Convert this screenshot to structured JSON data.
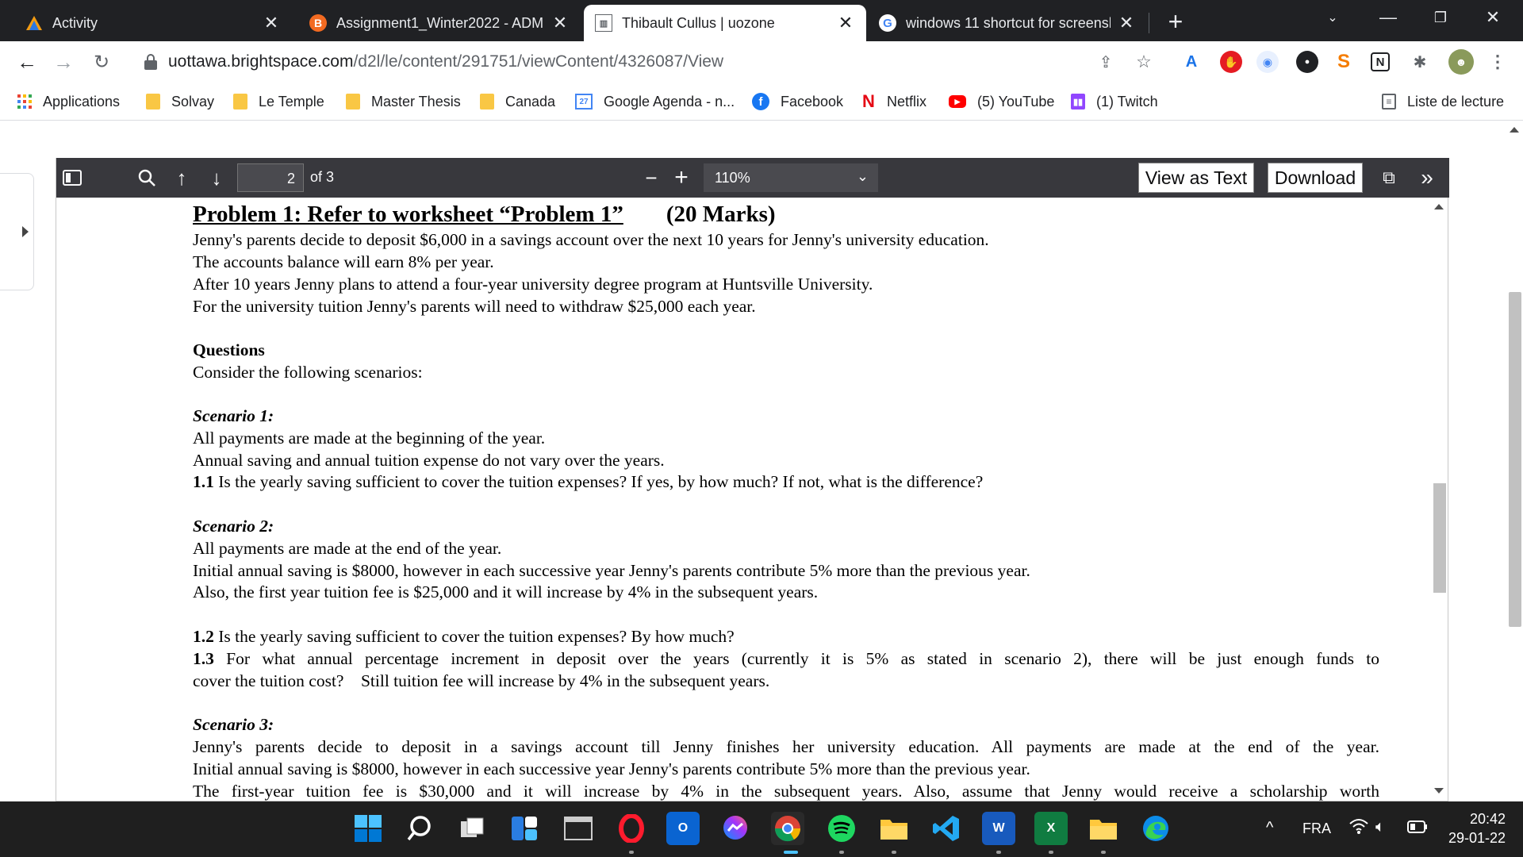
{
  "tabs": [
    {
      "title": "Activity",
      "icon": "activity-triangle-icon"
    },
    {
      "title": "Assignment1_Winter2022 - ADM",
      "icon": "brightspace-icon"
    },
    {
      "title": "Thibault Cullus | uozone",
      "icon": "uozone-icon"
    },
    {
      "title": "windows 11 shortcut for screensh",
      "icon": "google-icon"
    }
  ],
  "toolbar": {
    "url_host": "uottawa.brightspace.com",
    "url_path": "/d2l/le/content/291751/viewContent/4326087/View"
  },
  "bookmarks": [
    {
      "label": "Applications",
      "icon": "apps-grid-icon"
    },
    {
      "label": "Solvay",
      "icon": "folder-icon"
    },
    {
      "label": "Le Temple",
      "icon": "folder-icon"
    },
    {
      "label": "Master Thesis",
      "icon": "folder-icon"
    },
    {
      "label": "Canada",
      "icon": "folder-icon"
    },
    {
      "label": "Google Agenda - n...",
      "icon": "calendar-icon",
      "badge": "27"
    },
    {
      "label": "Facebook",
      "icon": "facebook-icon"
    },
    {
      "label": "Netflix",
      "icon": "netflix-icon"
    },
    {
      "label": "(5) YouTube",
      "icon": "youtube-icon"
    },
    {
      "label": "(1) Twitch",
      "icon": "twitch-icon"
    }
  ],
  "reading_list": "Liste de lecture",
  "pdf": {
    "page_current": "2",
    "page_total": "of 3",
    "zoom": "110%",
    "view_as_text": "View as Text",
    "download": "Download"
  },
  "doc": {
    "title": "Problem 1: Refer to worksheet “Problem 1”",
    "marks": "(20 Marks)",
    "intro": [
      "Jenny's parents decide to deposit $6,000 in a savings account over the next 10 years for Jenny's university education.",
      "The accounts balance will earn 8% per year.",
      "After 10 years Jenny plans to attend a four-year university degree program at Huntsville University.",
      "For the university tuition Jenny's parents will need to withdraw $25,000 each year."
    ],
    "questions_heading": "Questions",
    "questions_intro": "Consider the following scenarios:",
    "s1_title": "Scenario 1:",
    "s1_lines": [
      "All payments are made at the beginning of the year.",
      "Annual saving and annual tuition expense do not vary over the years."
    ],
    "q11_num": "1.1",
    "q11_text": " Is the yearly saving sufficient to cover the tuition expenses? If yes, by how much? If not, what is the difference?",
    "s2_title": "Scenario 2:",
    "s2_lines": [
      "All payments are made at the end of the year.",
      "Initial annual saving is $8000, however in each successive year Jenny's parents contribute 5% more than the previous year.",
      "Also, the first year tuition fee is $25,000 and it will increase by 4% in the subsequent years."
    ],
    "q12_num": "1.2",
    "q12_text": " Is the yearly saving sufficient to cover the tuition expenses? By how much?",
    "q13_num": "1.3",
    "q13_text": " For what annual percentage increment in deposit over the years (currently it is 5% as stated in scenario 2), there will be just enough funds to",
    "q13_cont": "cover the tuition cost?    Still tuition fee will increase by 4% in the subsequent years.",
    "s3_title": "Scenario 3:",
    "s3_lines": [
      "Jenny's parents decide to deposit in a savings account till Jenny finishes her university education. All payments are made at the end of the year.",
      "Initial annual saving is $8000, however in each successive year Jenny's parents contribute 5% more than the previous year.",
      "The first-year tuition fee is $30,000 and it will increase by 4% in the subsequent years. Also, assume that Jenny would receive a scholarship worth"
    ]
  },
  "tray": {
    "language": "FRA",
    "time": "20:42",
    "date": "29-01-22"
  }
}
